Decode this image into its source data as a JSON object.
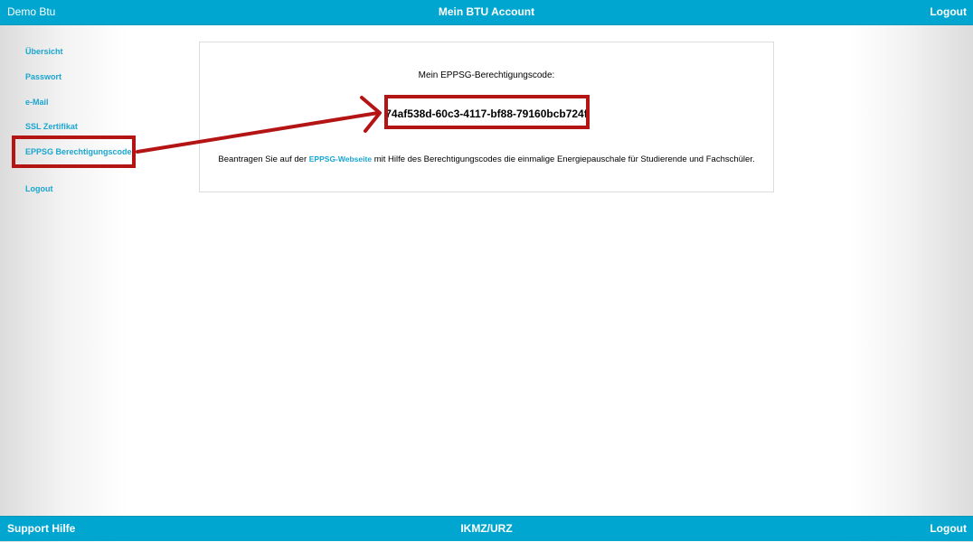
{
  "header": {
    "user_name": "Demo Btu",
    "title": "Mein BTU Account",
    "logout_label": "Logout"
  },
  "sidebar": {
    "items": [
      {
        "label": "Übersicht"
      },
      {
        "label": "Passwort"
      },
      {
        "label": "e-Mail"
      },
      {
        "label": "SSL Zertifikat"
      },
      {
        "label": "EPPSG Berechtigungscode"
      },
      {
        "label": "Logout"
      }
    ],
    "active_item": "EPPSG Berechtigungscode"
  },
  "main": {
    "code_label": "Mein EPPSG-Berechtigungscode:",
    "code_value": "74af538d-60c3-4117-bf88-79160bcb724f",
    "description_prefix": "Beantragen Sie auf der",
    "description_link": "EPPSG-Webseite",
    "description_suffix": "mit Hilfe des Berechtigungscodes die einmalige Energiepauschale für Studierende und Fachschüler."
  },
  "footer": {
    "support_label": "Support Hilfe",
    "center_label": "IKMZ/URZ",
    "logout_label": "Logout"
  },
  "colors": {
    "bar_background": "#00a6cf",
    "link_color": "#1aa6d0",
    "annotation_red": "#b41414"
  }
}
